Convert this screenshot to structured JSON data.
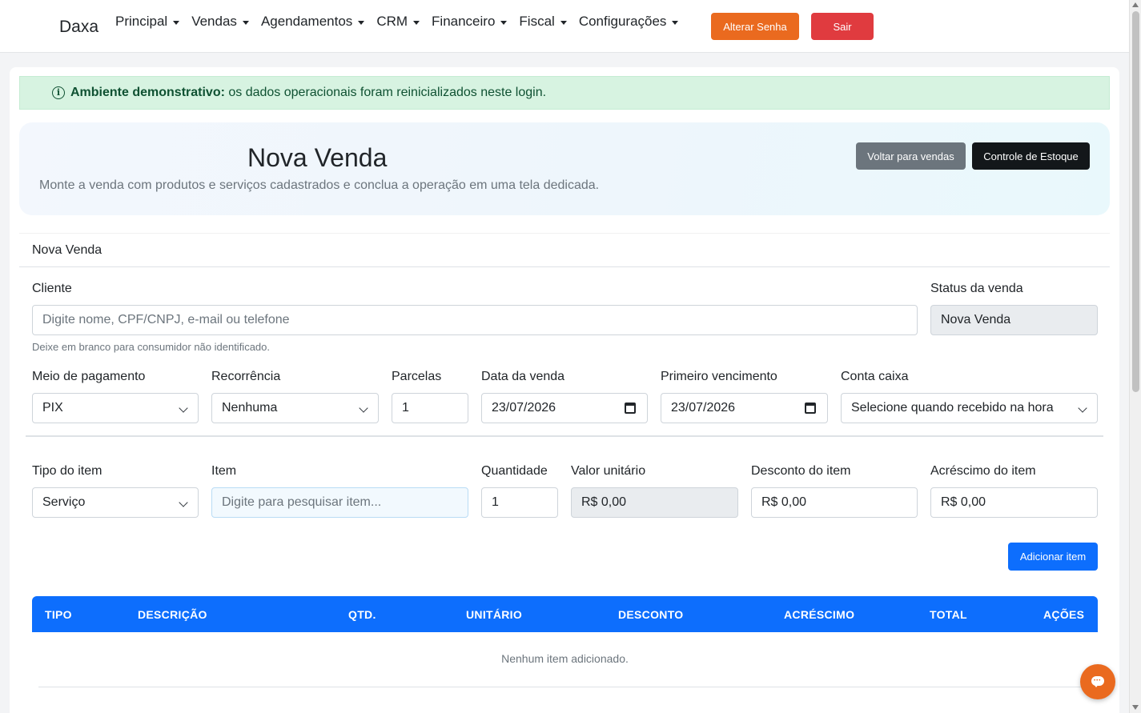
{
  "navbar": {
    "brand": "Daxa",
    "menu": [
      {
        "label": "Principal"
      },
      {
        "label": "Vendas"
      },
      {
        "label": "Agendamentos"
      },
      {
        "label": "CRM"
      },
      {
        "label": "Financeiro"
      },
      {
        "label": "Fiscal"
      },
      {
        "label": "Configurações"
      }
    ],
    "change_password_label": "Alterar Senha",
    "logout_label": "Sair"
  },
  "alert": {
    "strong": "Ambiente demonstrativo:",
    "text": " os dados operacionais foram reinicializados neste login."
  },
  "hero": {
    "title": "Nova Venda",
    "subtitle": "Monte a venda com produtos e serviços cadastrados e conclua a operação em uma tela dedicada.",
    "back_label": "Voltar para vendas",
    "stock_label": "Controle de Estoque"
  },
  "form": {
    "section_title": "Nova Venda",
    "cliente_label": "Cliente",
    "cliente_placeholder": "Digite nome, CPF/CNPJ, e-mail ou telefone",
    "cliente_help": "Deixe em branco para consumidor não identificado.",
    "status_label": "Status da venda",
    "status_value": "Nova Venda",
    "pagamento_label": "Meio de pagamento",
    "pagamento_value": "PIX",
    "recorrencia_label": "Recorrência",
    "recorrencia_value": "Nenhuma",
    "parcelas_label": "Parcelas",
    "parcelas_value": "1",
    "data_label": "Data da venda",
    "data_value": "23/07/2026",
    "vencimento_label": "Primeiro vencimento",
    "vencimento_value": "23/07/2026",
    "conta_label": "Conta caixa",
    "conta_value": "Selecione quando recebido na hora",
    "tipo_label": "Tipo do item",
    "tipo_value": "Serviço",
    "item_label": "Item",
    "item_placeholder": "Digite para pesquisar item...",
    "quantidade_label": "Quantidade",
    "quantidade_value": "1",
    "valor_label": "Valor unitário",
    "valor_value": "R$ 0,00",
    "desconto_label": "Desconto do item",
    "desconto_value": "R$ 0,00",
    "acrescimo_label": "Acréscimo do item",
    "acrescimo_value": "R$ 0,00",
    "add_item_label": "Adicionar item"
  },
  "table": {
    "headers": [
      "TIPO",
      "DESCRIÇÃO",
      "QTD.",
      "UNITÁRIO",
      "DESCONTO",
      "ACRÉSCIMO",
      "TOTAL",
      "AÇÕES"
    ],
    "empty_text": "Nenhum item adicionado."
  },
  "colors": {
    "accent_orange": "#ea6a1f",
    "danger_red": "#e03b3f",
    "primary_blue": "#0d6efd",
    "success_bg": "#d7f3e1"
  }
}
